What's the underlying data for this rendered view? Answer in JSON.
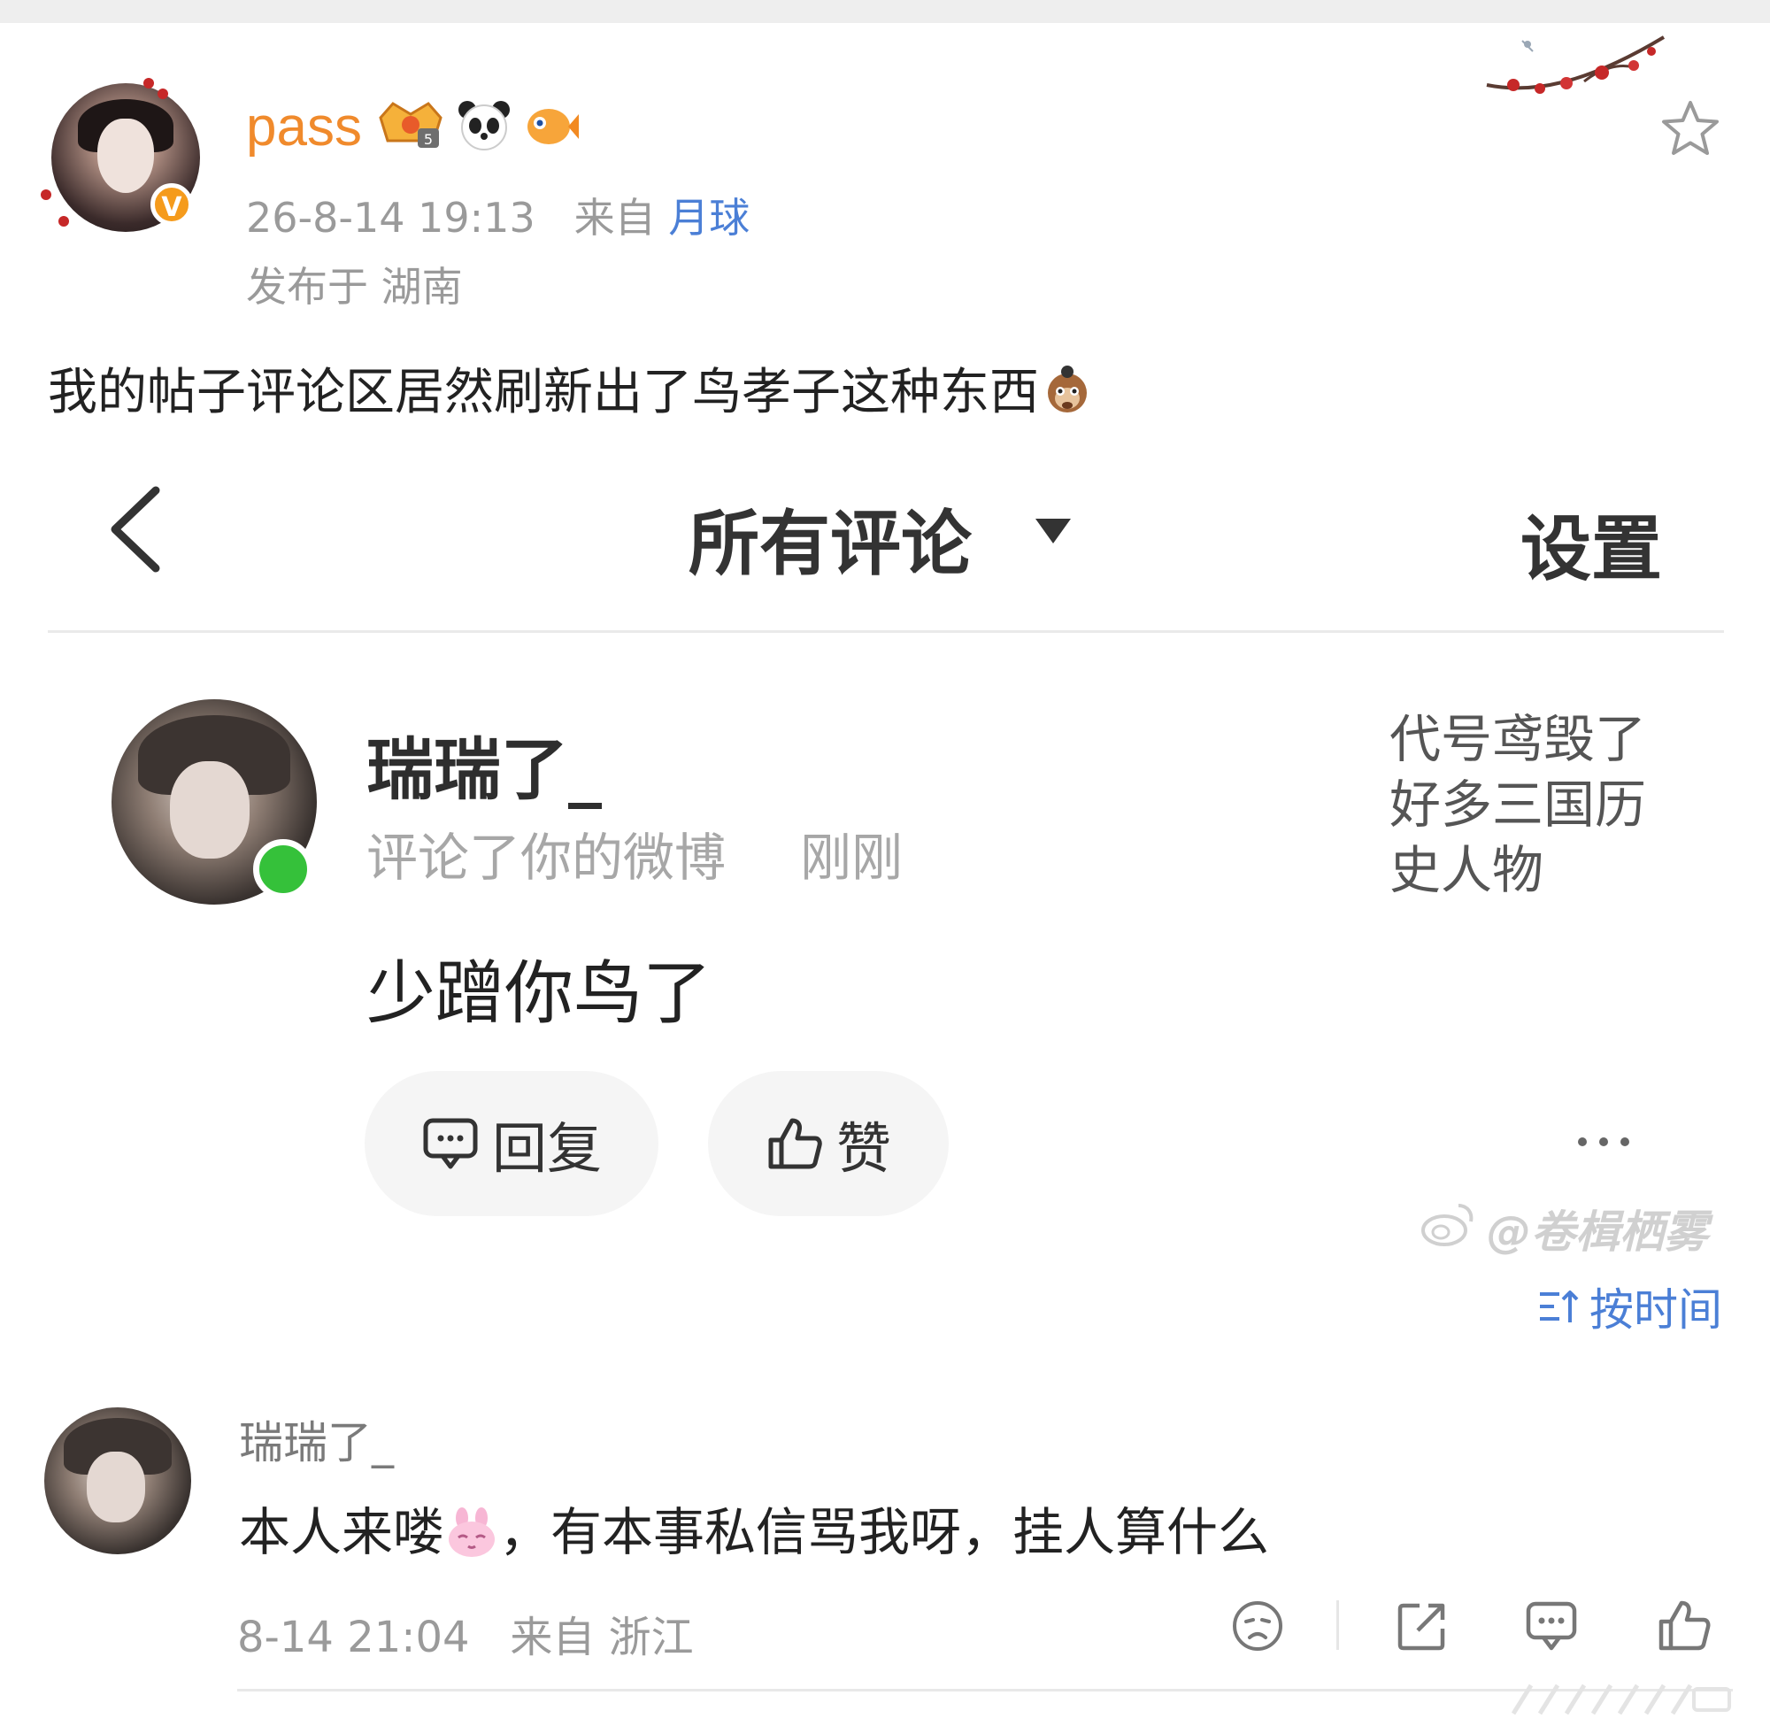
{
  "post": {
    "username": "pass",
    "date": "26-8-14 19:13",
    "from_label": "来自",
    "source": "月球",
    "location": "发布于 湖南",
    "text": "我的帖子评论区居然刷新出了鸟孝子这种东西",
    "verified_badge": "V"
  },
  "screenshot": {
    "sort_title": "所有评论",
    "settings_label": "设置",
    "comment": {
      "username": "瑞瑞了_",
      "action": "评论了你的微博",
      "time": "刚刚",
      "text": "少蹭你鸟了",
      "quoted_post": "代号鸢毁了好多三国历史人物",
      "reply_label": "回复",
      "like_label": "赞"
    }
  },
  "watermark": "@卷楫栖雾",
  "sort_by": "按时间",
  "reply": {
    "username": "瑞瑞了_",
    "text_before": "本人来喽",
    "text_after": "，有本事私信骂我呀，挂人算什么",
    "date": "8-14 21:04",
    "from_label": "来自",
    "location": "浙江"
  },
  "colors": {
    "username": "#f08a2c",
    "link_blue": "#4b7fd6",
    "online_green": "#35c13a",
    "verified_orange": "#f59b1c"
  }
}
